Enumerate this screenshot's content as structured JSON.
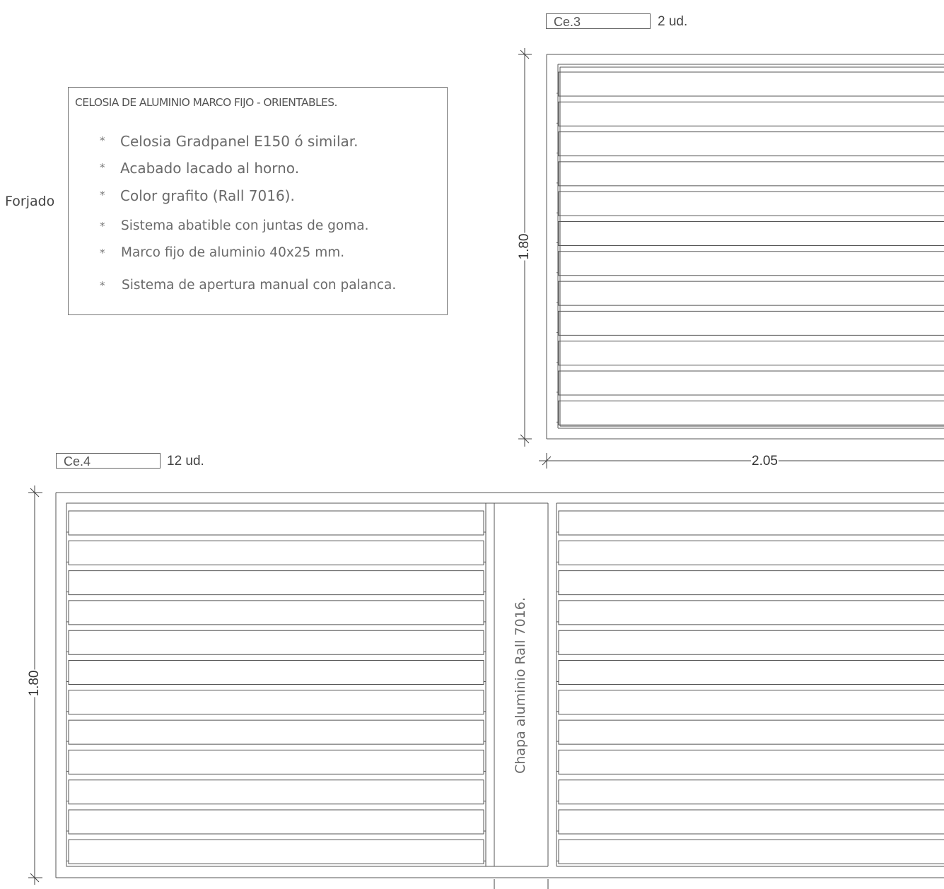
{
  "spec": {
    "title": "CELOSIA DE ALUMINIO MARCO FIJO - ORIENTABLES.",
    "bullet": "*",
    "items": [
      "Celosia Gradpanel E150 ó similar.",
      "Acabado lacado al horno.",
      "Color  grafito (Rall 7016).",
      "Sistema abatible con juntas de goma.",
      "Marco fijo de aluminio  40x25 mm.",
      "Sistema de apertura manual con palanca."
    ]
  },
  "side_label": "Forjado",
  "ce3": {
    "tag": "Ce.3",
    "quantity": "2 ud.",
    "height_dim": "1.80",
    "width_dim": "2.05",
    "slat_count": 12
  },
  "ce4": {
    "tag": "Ce.4",
    "quantity": "12 ud.",
    "height_dim": "1.80",
    "panel_note": "Chapa aluminio Rall 7016.",
    "slat_count": 12
  },
  "colors": {
    "line": "#555555",
    "text": "#4a4a4a"
  }
}
